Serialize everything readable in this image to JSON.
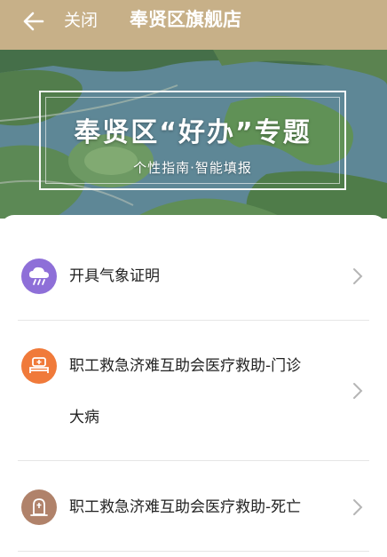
{
  "header": {
    "close_label": "关闭",
    "title": "奉贤区旗舰店",
    "back_icon": "arrow-left-icon",
    "bar_color": "#c7b088"
  },
  "banner": {
    "title": "奉贤区“好办”专题",
    "subtitle": "个性指南·智能填报"
  },
  "services": [
    {
      "label": "开具气象证明",
      "icon": "weather-cloud-icon",
      "color": "#8e6fd8"
    },
    {
      "label": "职工救急济难互助会医疗救助-门诊大病",
      "label_line1": "职工救急济难互助会医疗救助-门诊",
      "label_line2": "大病",
      "icon": "hospital-bed-icon",
      "color": "#f07a3a"
    },
    {
      "label": "职工救急济难互助会医疗救助-死亡",
      "icon": "tombstone-icon",
      "color": "#b0826a"
    }
  ]
}
